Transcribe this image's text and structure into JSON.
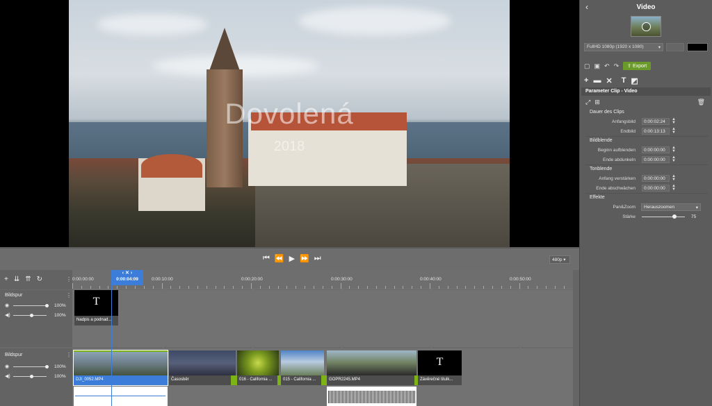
{
  "preview": {
    "overlay_title": "Dovolená",
    "overlay_subtitle": "2018"
  },
  "panel": {
    "title": "Video",
    "resolution": "FullHD 1080p (1920 x 1080)",
    "export_label": "Export",
    "section_title": "Parameter Clip - Video",
    "groups": {
      "duration": "Dauer des Clips",
      "fade": "Bildblende",
      "sound": "Tonblende",
      "effects": "Effekte"
    },
    "fields": {
      "start_label": "Anfangsbild",
      "start_value": "0:00:02:24",
      "end_label": "Endbild",
      "end_value": "0:00:13:13",
      "fade_in_label": "Beginn aufblenden",
      "fade_in_value": "0:00:00:00",
      "fade_out_label": "Ende abdunkeln",
      "fade_out_value": "0:00:00:00",
      "vol_in_label": "Anfang verstärken",
      "vol_in_value": "0:00:00:00",
      "vol_out_label": "Ende abschwächen",
      "vol_out_value": "0:00:00:00",
      "panzoom_label": "Pan&Zoom",
      "panzoom_value": "Herauszoomen",
      "strength_label": "Stärke",
      "strength_value": "75",
      "strength_level": 0.75
    },
    "colors": {
      "export_green": "#6a9a2a",
      "accent_blue": "#3b7dd8"
    }
  },
  "transport": {
    "quality": "480p"
  },
  "timeline": {
    "playhead_time": "0:00:04:09",
    "ruler_labels": [
      "0:00:00:00",
      "0:00:10:00",
      "0:00:20:00",
      "0:00:30:00",
      "0:00:40:00",
      "0:00:50:00"
    ],
    "tracks": [
      {
        "title": "Bildspur",
        "opacity": "100%",
        "volume": "100%"
      },
      {
        "title": "Bildspur",
        "opacity": "100%",
        "volume": "100%"
      }
    ],
    "title_clip": {
      "glyph": "T",
      "label": "Nadpis a podnad..."
    },
    "clips": [
      {
        "label": "DJI_0052.MP4"
      },
      {
        "label": "Časosběr"
      },
      {
        "label": "016 - California ..."
      },
      {
        "label": "015 - California ..."
      },
      {
        "label": "GOPR2245.MP4"
      }
    ],
    "end_clip": {
      "glyph": "T",
      "label": "Závěrečné titulk..."
    }
  }
}
